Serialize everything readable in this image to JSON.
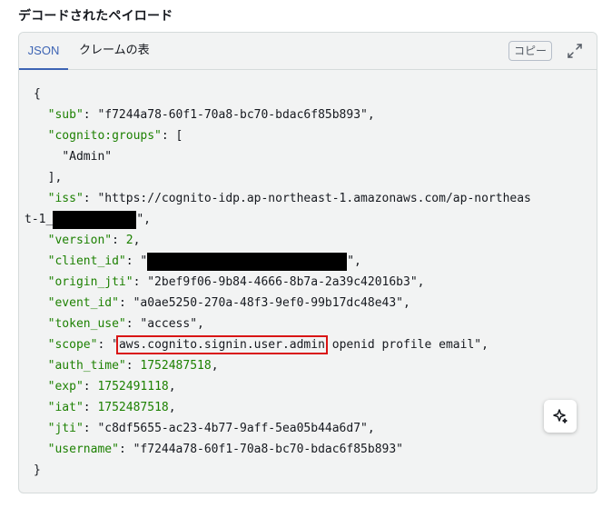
{
  "section_title": "デコードされたペイロード",
  "tabs": [
    {
      "label": "JSON",
      "active": true
    },
    {
      "label": "クレームの表",
      "active": false
    }
  ],
  "toolbar": {
    "copy_label": "コピー",
    "expand_icon": "expand-icon"
  },
  "payload": {
    "open_brace": "{",
    "close_brace": "}",
    "sub_key": "\"sub\"",
    "sub_value": "\"f7244a78-60f1-70a8-bc70-bdac6f85b893\",",
    "groups_key": "\"cognito:groups\"",
    "groups_open": "[",
    "groups_item": "\"Admin\"",
    "groups_close": "],",
    "iss_key": "\"iss\"",
    "iss_value_1": "\"https://cognito-idp.ap-northeast-1.amazonaws.com/ap-northeas",
    "iss_value_2_prefix": "t-1_",
    "iss_value_2_suffix": "\",",
    "version_key": "\"version\"",
    "version_value": "2",
    "client_id_key": "\"client_id\"",
    "client_id_open": "\"",
    "client_id_close": "\",",
    "origin_jti_key": "\"origin_jti\"",
    "origin_jti_value": "\"2bef9f06-9b84-4666-8b7a-2a39c42016b3\",",
    "event_id_key": "\"event_id\"",
    "event_id_value": "\"a0ae5250-270a-48f3-9ef0-99b17dc48e43\",",
    "token_use_key": "\"token_use\"",
    "token_use_value": "\"access\",",
    "scope_key": "\"scope\"",
    "scope_open": "\"",
    "scope_highlight": "aws.cognito.signin.user.admin",
    "scope_rest": " openid profile email\",",
    "auth_time_key": "\"auth_time\"",
    "auth_time_value": "1752487518",
    "exp_key": "\"exp\"",
    "exp_value": "1752491118",
    "iat_key": "\"iat\"",
    "iat_value": "1752487518",
    "jti_key": "\"jti\"",
    "jti_value": "\"c8df5655-ac23-4b77-9aff-5ea05b44a6d7\",",
    "username_key": "\"username\"",
    "username_value": "\"f7244a78-60f1-70a8-bc70-bdac6f85b893\""
  },
  "colors": {
    "key": "#1d8102",
    "accent": "#3d64b4",
    "highlight_border": "#d91515",
    "panel_bg": "#f2f3f3"
  },
  "floating_button_icon": "sparkle-icon"
}
